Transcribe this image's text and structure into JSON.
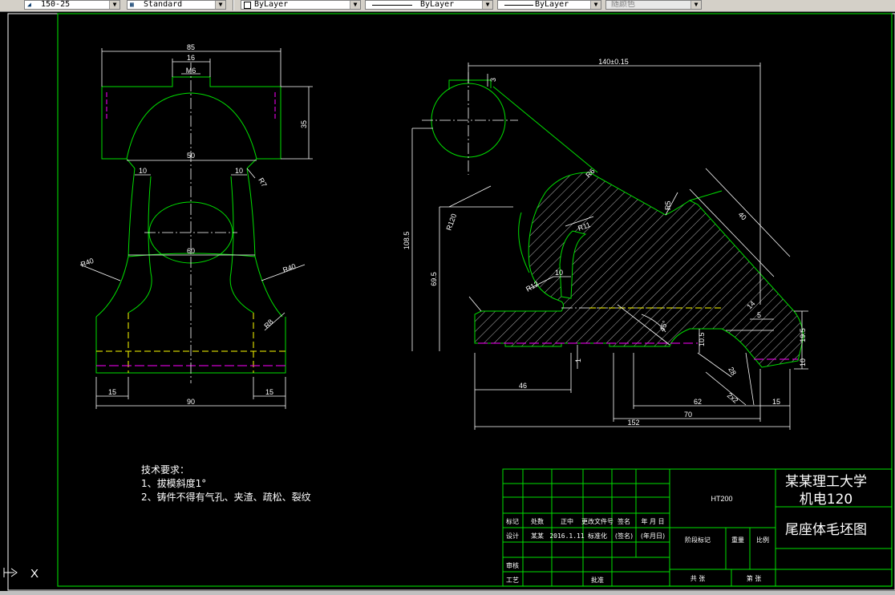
{
  "toolbar": {
    "dimstyle": "150-25",
    "tablestyle": "Standard",
    "layer": "ByLayer",
    "linetype": "ByLayer",
    "lineweight": "ByLayer",
    "plotstyle": "随颜色"
  },
  "front_view": {
    "dim_85": "85",
    "dim_16": "16",
    "dim_m6": "M6",
    "dim_35": "35",
    "dim_50": "50",
    "dim_10_left": "10",
    "dim_10_right": "10",
    "dim_r7": "R7",
    "dim_60": "60",
    "dim_r40_left": "R40",
    "dim_r40_right": "R40",
    "dim_r8": "R8",
    "dim_15_left": "15",
    "dim_15_right": "15",
    "dim_90": "90"
  },
  "side_view": {
    "dim_140": "140±0.15",
    "dim_3": "3",
    "dim_108_5": "108.5",
    "dim_r120": "R120",
    "dim_69_5": "69.5",
    "dim_r6": "R6",
    "dim_5": "5",
    "dim_r11": "R11",
    "dim_r12": "R12",
    "dim_10": "10",
    "dim_40": "40",
    "dim_r5": "R5",
    "dim_45": "45°",
    "dim_10_5": "10.5",
    "dim_1": "1",
    "dim_14": "14",
    "dim_5_small": "5",
    "dim_19_5": "19.5",
    "dim_10_r": "10",
    "dim_46": "46",
    "dim_62": "62",
    "dim_15": "15",
    "dim_70": "70",
    "dim_152": "152",
    "dim_28": "28",
    "dim_2x2": "2x2"
  },
  "notes": {
    "title": "技术要求：",
    "line1": "1、拔模斜度1°",
    "line2": "2、铸件不得有气孔、夹渣、疏松、裂纹"
  },
  "title_block": {
    "material": "HT200",
    "university": "某某理工大学",
    "class_name": "机电120",
    "drawing_name": "尾座体毛坯图",
    "h_biaoji": "标记",
    "h_chushu": "处数",
    "h_zhengzhong": "正中",
    "h_gengai": "更改文件号",
    "h_qianming": "签名",
    "h_nianyueri": "年 月 日",
    "r_sheji": "设计",
    "r_moumou": "某某",
    "r_date": "2016.1.11",
    "r_biaozhunhua": "标准化",
    "r_qianming2": "(签名)",
    "r_nianyueri2": "(年月日)",
    "jieduanbiaoji": "阶段标记",
    "zhongliang": "重量",
    "bili": "比例",
    "shenhe": "审核",
    "gongyi": "工艺",
    "pizhun": "批准",
    "gongzhang": "共  张",
    "dizhang": "第  张"
  },
  "ucs": {
    "x_label": "X"
  },
  "colors": {
    "frame": "#00c800",
    "outline": "#00e000",
    "dimension": "#ffffff",
    "hidden": "#ffff00",
    "center": "#ff00ff",
    "background": "#000000"
  }
}
